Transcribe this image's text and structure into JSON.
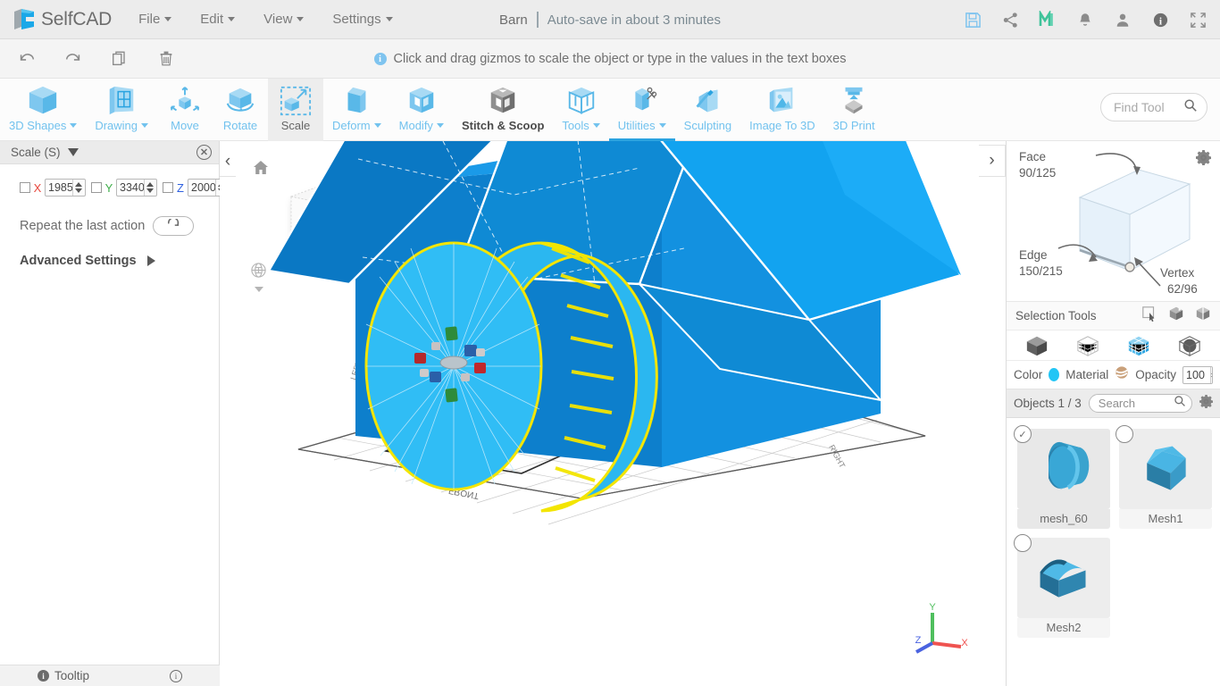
{
  "menubar": {
    "brand": "SelfCAD",
    "brand_icon": "selfcad-logo-icon",
    "items": [
      {
        "label": "File",
        "icon": "caret-down-icon"
      },
      {
        "label": "Edit",
        "icon": "caret-down-icon"
      },
      {
        "label": "View",
        "icon": "caret-down-icon"
      },
      {
        "label": "Settings",
        "icon": "caret-down-icon"
      }
    ],
    "document_title": "Barn",
    "autosave_status": "Auto-save in about 3 minutes",
    "right_icons": [
      {
        "name": "save-icon",
        "glyph": "save"
      },
      {
        "name": "share-icon",
        "glyph": "share"
      },
      {
        "name": "m-logo-icon",
        "glyph": "M"
      },
      {
        "name": "notifications-bell-icon",
        "glyph": "bell"
      },
      {
        "name": "user-account-icon",
        "glyph": "user"
      },
      {
        "name": "info-icon",
        "glyph": "info"
      },
      {
        "name": "fullscreen-icon",
        "glyph": "fullscreen"
      }
    ]
  },
  "subbar": {
    "history": [
      {
        "name": "undo-button",
        "glyph": "undo"
      },
      {
        "name": "redo-button",
        "glyph": "redo"
      },
      {
        "name": "copy-button",
        "glyph": "copy"
      },
      {
        "name": "delete-button",
        "glyph": "trash"
      }
    ],
    "hint_icon": "info-icon",
    "hint": "Click and drag gizmos to scale the object or type in the values in the text boxes"
  },
  "toolbar": {
    "tools": [
      {
        "label": "3D Shapes",
        "icon": "cube-icon",
        "dropdown": true,
        "active": false,
        "style": "blue"
      },
      {
        "label": "Drawing",
        "icon": "drawing-icon",
        "dropdown": true,
        "active": false,
        "style": "blue"
      },
      {
        "label": "Move",
        "icon": "move-icon",
        "dropdown": false,
        "active": false,
        "style": "blue"
      },
      {
        "label": "Rotate",
        "icon": "rotate-icon",
        "dropdown": false,
        "active": false,
        "style": "blue"
      },
      {
        "label": "Scale",
        "icon": "scale-icon",
        "dropdown": false,
        "active": true,
        "style": "blue"
      },
      {
        "label": "Deform",
        "icon": "deform-icon",
        "dropdown": true,
        "active": false,
        "style": "blue"
      },
      {
        "label": "Modify",
        "icon": "modify-icon",
        "dropdown": true,
        "active": false,
        "style": "blue"
      },
      {
        "label": "Stitch & Scoop",
        "icon": "stitch-scoop-icon",
        "dropdown": false,
        "active": false,
        "style": "dark"
      },
      {
        "label": "Tools",
        "icon": "tools-icon",
        "dropdown": true,
        "active": false,
        "style": "blue"
      },
      {
        "label": "Utilities",
        "icon": "utilities-icon",
        "dropdown": true,
        "active": false,
        "style": "blue"
      },
      {
        "label": "Sculpting",
        "icon": "sculpting-icon",
        "dropdown": false,
        "active": false,
        "style": "blue"
      },
      {
        "label": "Image To 3D",
        "icon": "image-to-3d-icon",
        "dropdown": false,
        "active": false,
        "style": "blue"
      },
      {
        "label": "3D Print",
        "icon": "3d-print-icon",
        "dropdown": false,
        "active": false,
        "style": "blue"
      }
    ],
    "find_tool_placeholder": "Find Tool",
    "find_tool_icon": "search-icon"
  },
  "left_panel": {
    "title": "Scale (S)",
    "collapse_icon": "triangle-down-icon",
    "close_icon": "close-icon",
    "axes": [
      {
        "axis": "X",
        "value": "1985",
        "checked": false,
        "color": "#e8483e"
      },
      {
        "axis": "Y",
        "value": "3340",
        "checked": false,
        "color": "#3fae4a"
      },
      {
        "axis": "Z",
        "value": "2000",
        "checked": false,
        "color": "#2d5fe0"
      }
    ],
    "repeat_label": "Repeat the last action",
    "repeat_icon": "refresh-icon",
    "advanced_label": "Advanced Settings",
    "advanced_icon": "triangle-right-icon",
    "footer": {
      "tooltip_label": "Tooltip",
      "tooltip_icon": "info-filled-icon",
      "right_icon": "info-outline-icon"
    }
  },
  "viewport": {
    "collapse_left_icon": "chevron-left-icon",
    "home_icon": "home-icon",
    "snap_icon_1": "snap-square-icon",
    "snap_icon_2": "snap-globe-icon",
    "view_cube_label": "FRONT",
    "view_cube_side_label": "RIGHT",
    "grid_labels": [
      "LEFT",
      "FRONT",
      "RIGHT"
    ],
    "axis_gizmo": {
      "x": "X",
      "y": "Y",
      "z": "Z",
      "x_color": "#e8483e",
      "y_color": "#3fae4a",
      "z_color": "#2d5fe0"
    },
    "model": {
      "barn_body_color": "#0b82d0",
      "barn_roof_color": "#12a0ef",
      "selected_object_color": "#2bb7f0",
      "selection_outline_color": "#f3e500"
    }
  },
  "right_panel": {
    "collapse_icon": "chevron-right-icon",
    "settings_gear_icon": "gear-icon",
    "selection_counts": [
      {
        "label": "Face",
        "value": "90/125"
      },
      {
        "label": "Edge",
        "value": "150/215"
      },
      {
        "label": "Vertex",
        "value": "62/96"
      }
    ],
    "selection_tools_label": "Selection Tools",
    "selection_tool_icons": [
      "rectangle-select-icon",
      "box-select-icon",
      "lasso-select-icon"
    ],
    "mode_icons": [
      "object-mode-icon",
      "wireframe-mode-icon",
      "face-mode-icon",
      "vertex-mode-icon"
    ],
    "color_label": "Color",
    "color_value": "#22c5f5",
    "material_label": "Material",
    "material_icon": "material-sphere-icon",
    "opacity_label": "Opacity",
    "opacity_value": "100",
    "objects_label": "Objects 1 / 3",
    "search_placeholder": "Search",
    "search_icon": "search-icon",
    "objects_gear_icon": "gear-icon",
    "objects": [
      {
        "name": "mesh_60",
        "selected": true,
        "shape": "cylinder"
      },
      {
        "name": "Mesh1",
        "selected": false,
        "shape": "barn"
      },
      {
        "name": "Mesh2",
        "selected": false,
        "shape": "roof"
      }
    ]
  }
}
